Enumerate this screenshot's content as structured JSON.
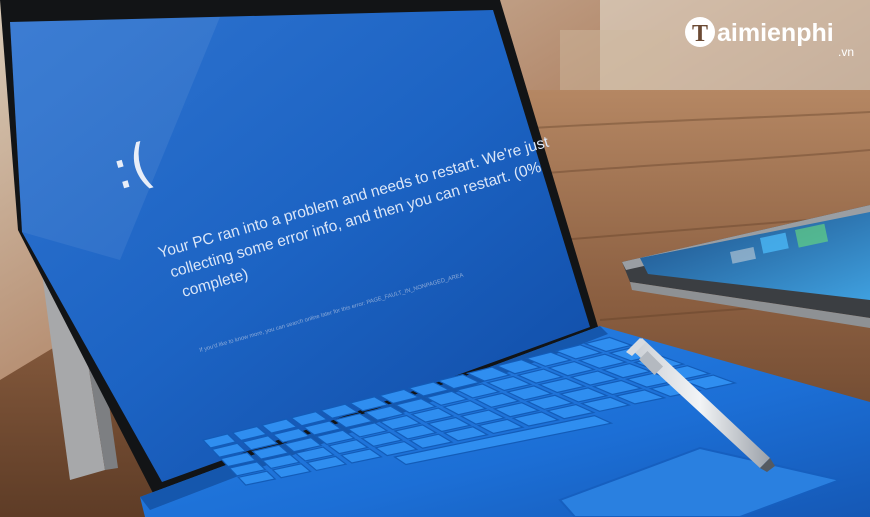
{
  "bsod": {
    "face": ":(",
    "message_lines": [
      "Your PC ran into a problem and needs to restart. We're just",
      "collecting some error info, and then you can restart. (0%",
      "complete)"
    ],
    "detail_line": "If you'd like to know more, you can search online later for this error: PAGE_FAULT_IN_NONPAGED_AREA",
    "progress_percent": 0
  },
  "watermark": {
    "initial": "T",
    "name": "aimienphi",
    "tld": ".vn"
  },
  "colors": {
    "bsod_blue": "#1a5fc0",
    "keyboard_cover_blue": "#1f72d6",
    "wood": "#7d563c"
  }
}
